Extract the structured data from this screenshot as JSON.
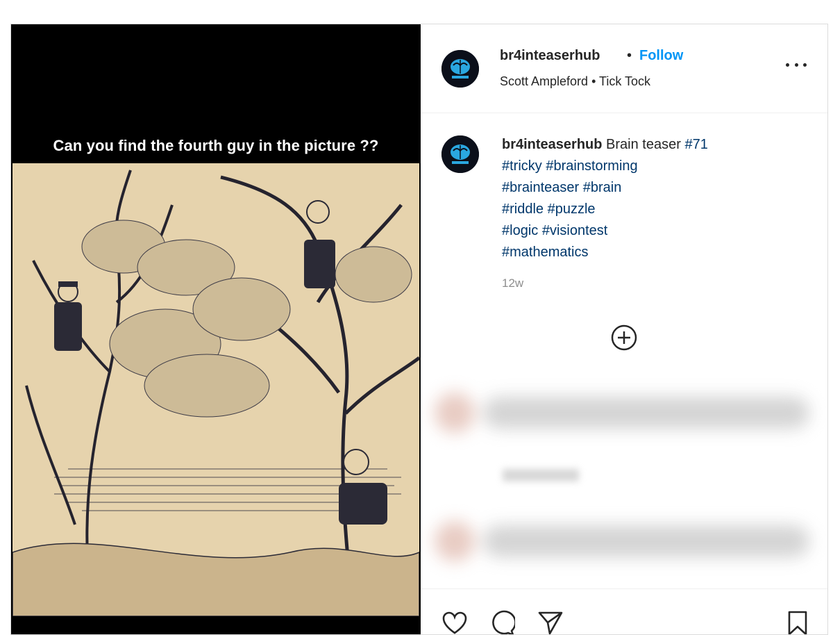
{
  "post": {
    "image_overlay_text": "Can you find the fourth guy in the picture ??"
  },
  "header": {
    "username": "br4inteaserhub",
    "separator": "•",
    "follow_label": "Follow",
    "subline": "Scott Ampleford • Tick Tock",
    "more_icon": "more-horizontal-icon"
  },
  "caption": {
    "username": "br4inteaserhub",
    "text": "Brain teaser",
    "hashtags_line1": [
      "#71"
    ],
    "hashtags": [
      [
        "#tricky",
        "#brainstorming"
      ],
      [
        "#brainteaser",
        "#brain"
      ],
      [
        "#riddle",
        "#puzzle"
      ],
      [
        "#logic",
        "#visiontest"
      ],
      [
        "#mathematics"
      ]
    ],
    "time": "12w"
  },
  "load_more_icon": "plus-circle-icon",
  "actions": {
    "icons": [
      "heart-icon",
      "comment-icon",
      "share-icon",
      "bookmark-icon"
    ]
  },
  "colors": {
    "follow": "#0095f6",
    "hashtag": "#00376b",
    "muted": "#8e8e8e",
    "media_bg": "#000000",
    "sketch_paper": "#e6d3ad"
  }
}
